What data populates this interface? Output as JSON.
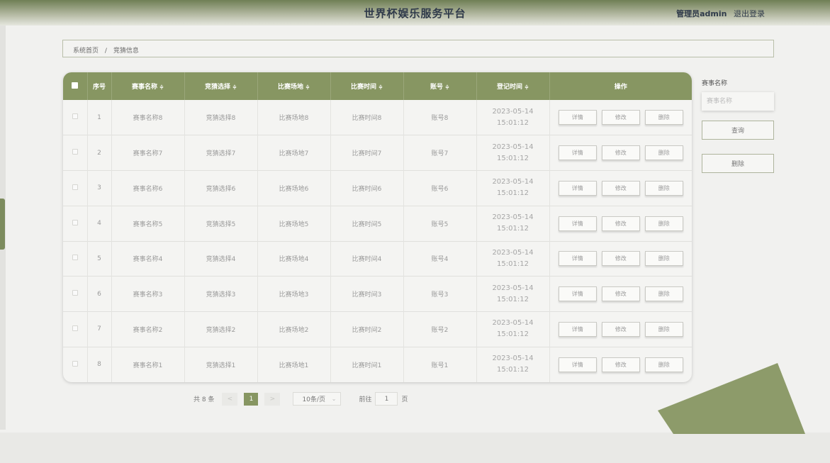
{
  "header": {
    "title": "世界杯娱乐服务平台",
    "role": "管理员",
    "username": "admin",
    "logout": "退出登录"
  },
  "breadcrumb": {
    "home": "系统首页",
    "separator": "/",
    "current": "竞猜信息"
  },
  "table": {
    "columns": [
      "序号",
      "赛事名称",
      "竞猜选择",
      "比赛场地",
      "比赛时间",
      "账号",
      "登记时间",
      "操作"
    ],
    "sort_icon": "≑",
    "rows": [
      {
        "index": "1",
        "event": "赛事名称8",
        "choice": "竞猜选择8",
        "venue": "比赛场地8",
        "time": "比赛时间8",
        "account": "账号8",
        "reg_time": "2023-05-14 15:01:12"
      },
      {
        "index": "2",
        "event": "赛事名称7",
        "choice": "竞猜选择7",
        "venue": "比赛场地7",
        "time": "比赛时间7",
        "account": "账号7",
        "reg_time": "2023-05-14 15:01:12"
      },
      {
        "index": "3",
        "event": "赛事名称6",
        "choice": "竞猜选择6",
        "venue": "比赛场地6",
        "time": "比赛时间6",
        "account": "账号6",
        "reg_time": "2023-05-14 15:01:12"
      },
      {
        "index": "4",
        "event": "赛事名称5",
        "choice": "竞猜选择5",
        "venue": "比赛场地5",
        "time": "比赛时间5",
        "account": "账号5",
        "reg_time": "2023-05-14 15:01:12"
      },
      {
        "index": "5",
        "event": "赛事名称4",
        "choice": "竞猜选择4",
        "venue": "比赛场地4",
        "time": "比赛时间4",
        "account": "账号4",
        "reg_time": "2023-05-14 15:01:12"
      },
      {
        "index": "6",
        "event": "赛事名称3",
        "choice": "竞猜选择3",
        "venue": "比赛场地3",
        "time": "比赛时间3",
        "account": "账号3",
        "reg_time": "2023-05-14 15:01:12"
      },
      {
        "index": "7",
        "event": "赛事名称2",
        "choice": "竞猜选择2",
        "venue": "比赛场地2",
        "time": "比赛时间2",
        "account": "账号2",
        "reg_time": "2023-05-14 15:01:12"
      },
      {
        "index": "8",
        "event": "赛事名称1",
        "choice": "竞猜选择1",
        "venue": "比赛场地1",
        "time": "比赛时间1",
        "account": "账号1",
        "reg_time": "2023-05-14 15:01:12"
      }
    ],
    "actions": {
      "detail": "详情",
      "edit": "修改",
      "delete": "删除"
    }
  },
  "search": {
    "label": "赛事名称",
    "placeholder": "赛事名称",
    "query_button": "查询",
    "delete_button": "删除"
  },
  "pagination": {
    "total": "共 8 条",
    "prev": "<",
    "current_page": "1",
    "next": ">",
    "page_size": "10条/页",
    "goto_label": "前往",
    "goto_value": "1",
    "page_unit": "页"
  },
  "colors": {
    "accent": "#879662",
    "header_dark": "#6f7f55",
    "background": "#f1f1ef"
  }
}
